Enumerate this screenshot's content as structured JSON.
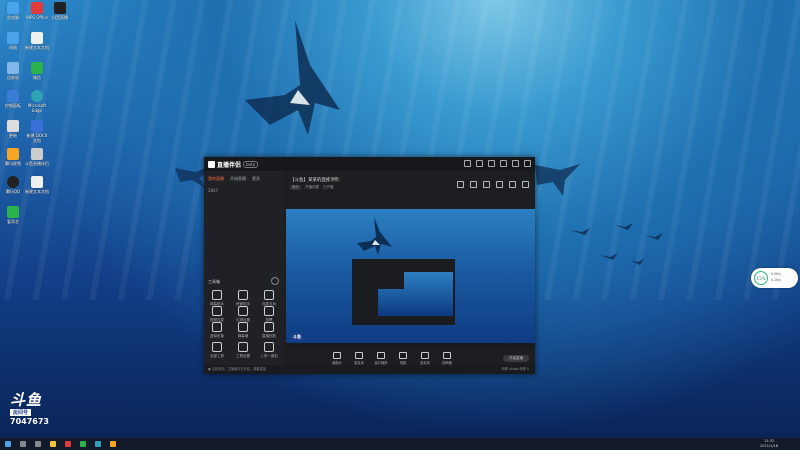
{
  "desktop": {
    "icons": [
      {
        "label": "此电脑",
        "icon": "computer-icon",
        "color": "#4aa3e8"
      },
      {
        "label": "WPS Office",
        "icon": "wps-icon",
        "color": "#e23a3a"
      },
      {
        "label": "抖音直播",
        "icon": "app-icon",
        "color": "#222222"
      },
      {
        "label": "网络",
        "icon": "network-icon",
        "color": "#4aa3e8"
      },
      {
        "label": "新建文本文档",
        "icon": "document-icon",
        "color": "#eeeeee"
      },
      {
        "label": "回收站",
        "icon": "recycle-bin-icon",
        "color": "#7fb8e8"
      },
      {
        "label": "微信",
        "icon": "wechat-icon",
        "color": "#2ab34a"
      },
      {
        "label": "控制面板",
        "icon": "control-panel-icon",
        "color": "#3a7bd5"
      },
      {
        "label": "Microsoft Edge",
        "icon": "edge-icon",
        "color": "#2fa3b5"
      },
      {
        "label": "更新",
        "icon": "document-icon",
        "color": "#dddddd"
      },
      {
        "label": "新建 DOCX 文档",
        "icon": "docx-icon",
        "color": "#3a6fd8"
      },
      {
        "label": "腾讯视频",
        "icon": "video-icon",
        "color": "#f5a623"
      },
      {
        "label": "斗鱼直播伴侣",
        "icon": "douyu-icon",
        "color": "#cccccc"
      },
      {
        "label": "腾讯QQ",
        "icon": "qq-icon",
        "color": "#222222"
      },
      {
        "label": "新建文本文档",
        "icon": "document-icon",
        "color": "#eeeeee"
      },
      {
        "label": "爱奇艺",
        "icon": "iqiyi-icon",
        "color": "#2ab34a"
      }
    ]
  },
  "app": {
    "name": "直播伴侣",
    "version": "beta",
    "tabs": [
      "我的直播",
      "开始直播",
      "更多"
    ],
    "uid": "2847",
    "tools_title": "工具箱",
    "tools": [
      {
        "label": "弹幕助手",
        "icon": "danmaku-icon"
      },
      {
        "label": "房管助手",
        "icon": "manager-icon"
      },
      {
        "label": "连麦互动",
        "icon": "mic-icon"
      },
      {
        "label": "视频连麦",
        "icon": "video-link-icon"
      },
      {
        "label": "礼物设置",
        "icon": "gift-icon"
      },
      {
        "label": "投票",
        "icon": "vote-icon"
      },
      {
        "label": "虚拟形象",
        "icon": "avatar-icon"
      },
      {
        "label": "弹幕墙",
        "icon": "wall-icon"
      },
      {
        "label": "直播回放",
        "icon": "replay-icon"
      },
      {
        "label": "全部工具",
        "icon": "all-tools-icon"
      },
      {
        "label": "工具设置",
        "icon": "settings-icon"
      },
      {
        "label": "上传一键包",
        "icon": "upload-icon"
      }
    ],
    "room_title": "【斗鱼】某某的直播间",
    "room_tag": "编辑",
    "room_sub": [
      "娱乐",
      "开播设置",
      "已开播"
    ],
    "controls": [
      {
        "label": "摄像头",
        "icon": "camera-icon"
      },
      {
        "label": "麦克风",
        "icon": "microphone-icon"
      },
      {
        "label": "窗口捕获",
        "icon": "window-capture-icon"
      },
      {
        "label": "视频",
        "icon": "video-icon"
      },
      {
        "label": "麦克风",
        "icon": "mic-icon"
      },
      {
        "label": "扬声器",
        "icon": "speaker-icon"
      }
    ],
    "start_button": "开始直播",
    "status_left": "● 当前状态：主播版本已开启，弹幕连接",
    "status_right": "码率  0kbps  帧率  0"
  },
  "widget": {
    "percent": "15%",
    "up": "0.0K/s",
    "down": "0.1K/s"
  },
  "watermark": {
    "logo": "斗鱼",
    "room_label": "房间号",
    "room_id": "7047673"
  },
  "taskbar": {
    "time": "11:32",
    "date": "2021/1/18"
  }
}
